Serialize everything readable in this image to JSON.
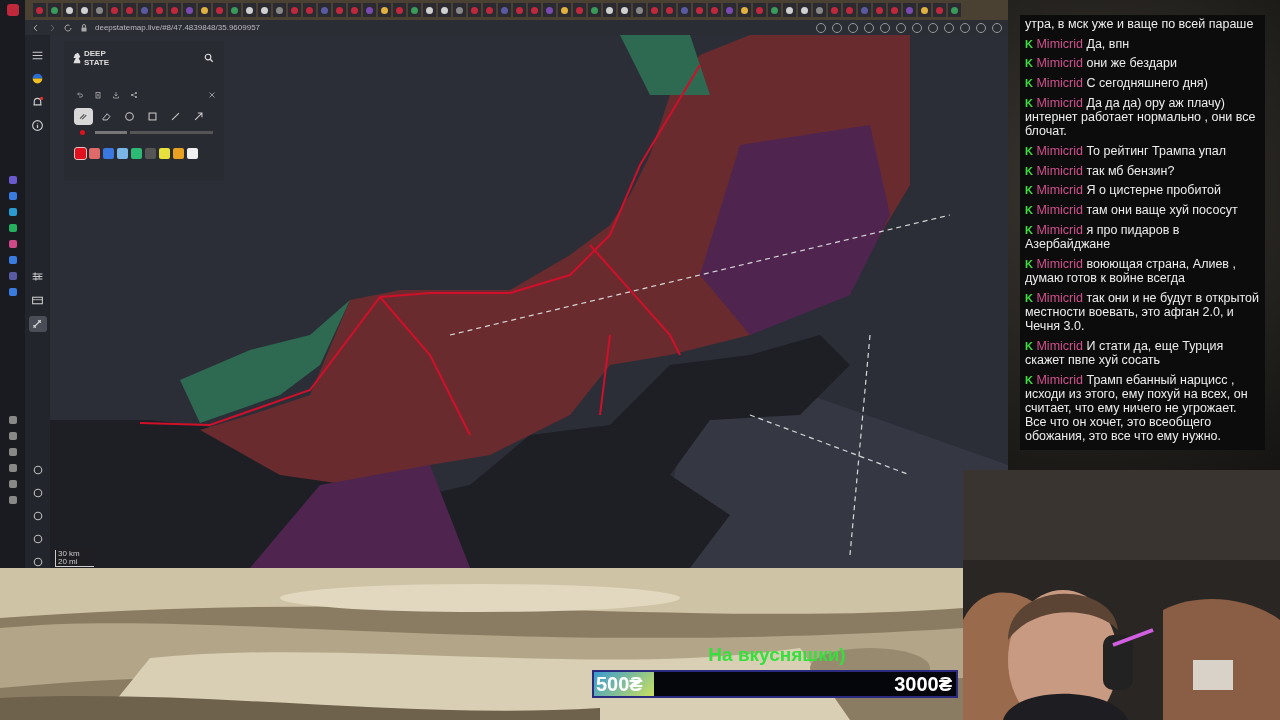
{
  "browser": {
    "url": "deepstatemap.live/#8/47.4839848/35.9609957"
  },
  "site_sidebar": [
    {
      "kind": "menu",
      "selected": false
    },
    {
      "kind": "flag",
      "selected": false
    },
    {
      "kind": "bell",
      "selected": false
    },
    {
      "kind": "info",
      "selected": false
    },
    {
      "kind": "layers",
      "selected": false
    },
    {
      "kind": "card",
      "selected": false
    },
    {
      "kind": "draw",
      "selected": true
    }
  ],
  "map_panel": {
    "logo": [
      "DEEP",
      "STATE"
    ],
    "actions": [
      {
        "kind": "undo"
      },
      {
        "kind": "delete"
      },
      {
        "kind": "download"
      },
      {
        "kind": "share"
      },
      {
        "kind": "close"
      }
    ],
    "tools": [
      {
        "kind": "pen",
        "selected": true
      },
      {
        "kind": "eraser",
        "selected": false
      },
      {
        "kind": "circle",
        "selected": false
      },
      {
        "kind": "square",
        "selected": false
      },
      {
        "kind": "line",
        "selected": false
      },
      {
        "kind": "arrow",
        "selected": false
      }
    ],
    "stroke": {
      "color": "#e0101e",
      "level": 0.3
    },
    "colors": [
      {
        "color": "#e0101e",
        "selected": true
      },
      {
        "color": "#e06a6a",
        "selected": false
      },
      {
        "color": "#3a78e0",
        "selected": false
      },
      {
        "color": "#7ab6e6",
        "selected": false
      },
      {
        "color": "#2dba74",
        "selected": false
      },
      {
        "color": "#555555",
        "selected": false
      },
      {
        "color": "#e6e03c",
        "selected": false
      },
      {
        "color": "#e8a020",
        "selected": false
      },
      {
        "color": "#f0f0f0",
        "selected": false
      }
    ]
  },
  "map": {
    "scale": [
      "30 km",
      "20 mi"
    ]
  },
  "chat": {
    "first_line": "утра, в мск уже и ваще по всей параше",
    "messages": [
      {
        "badge": "K",
        "user": "Mimicrid",
        "text": "Да, впн"
      },
      {
        "badge": "K",
        "user": "Mimicrid",
        "text": "они же бездари"
      },
      {
        "badge": "K",
        "user": "Mimicrid",
        "text": "С сегодняшнего дня)"
      },
      {
        "badge": "K",
        "user": "Mimicrid",
        "text": "Да да да) ору аж плачу) интернет работает нормально , они все блочат."
      },
      {
        "badge": "K",
        "user": "Mimicrid",
        "text": "То рейтинг Трампа упал"
      },
      {
        "badge": "K",
        "user": "Mimicrid",
        "text": "так мб бензин?"
      },
      {
        "badge": "K",
        "user": "Mimicrid",
        "text": "Я о цистерне пробитой"
      },
      {
        "badge": "K",
        "user": "Mimicrid",
        "text": "там они ваще хуй пососут"
      },
      {
        "badge": "K",
        "user": "Mimicrid",
        "text": "я про пидаров в Азербайджане"
      },
      {
        "badge": "K",
        "user": "Mimicrid",
        "text": "воюющая страна, Алиев , думаю готов к войне всегда"
      },
      {
        "badge": "K",
        "user": "Mimicrid",
        "text": "так они и не будут в открытой местности воевать, это афган 2.0, и Чечня 3.0."
      },
      {
        "badge": "K",
        "user": "Mimicrid",
        "text": "И стати да, еще Турция скажет пвпе хуй сосать"
      },
      {
        "badge": "K",
        "user": "Mimicrid",
        "text": "Трамп ебанный нарцисс , исходи из этого, ему похуй на всех, он считает, что ему ничего не угрожает. Все что он хочет, это всеобщего обожания, это все что ему нужно."
      }
    ]
  },
  "donation": {
    "title": "На вкусняшки)",
    "current": "500₴",
    "goal": "3000₴",
    "level": 0.167
  }
}
